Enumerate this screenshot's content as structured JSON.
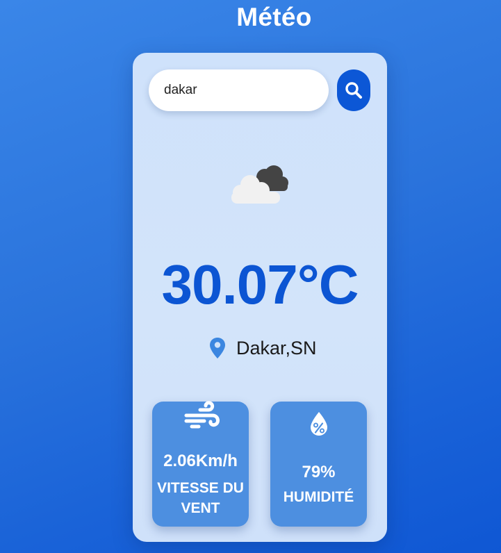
{
  "app": {
    "title": "Météo"
  },
  "search": {
    "value": "dakar",
    "placeholder": "",
    "button_icon": "search-icon"
  },
  "weather": {
    "icon": "cloudy-icon",
    "temperature": "30.07°C",
    "location": "Dakar,SN",
    "location_icon": "map-pin-icon"
  },
  "stats": {
    "wind": {
      "icon": "wind-icon",
      "value": "2.06Km/h",
      "label": "VITESSE DU VENT"
    },
    "humidity": {
      "icon": "humidity-icon",
      "value": "79%",
      "label": "HUMIDITÉ"
    }
  },
  "colors": {
    "accent": "#0c57d6",
    "stat_box": "#4d8fe0",
    "card": "#d0e2fa",
    "location_pin": "#3b86e0"
  }
}
